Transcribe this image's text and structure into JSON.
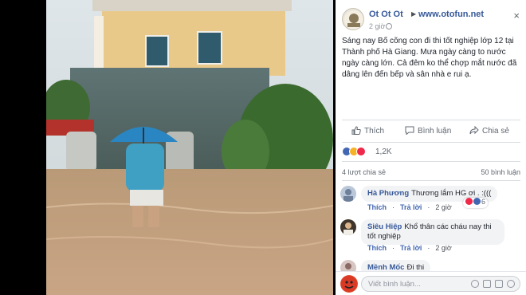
{
  "post": {
    "author": "Ot Ot Ot",
    "arrow": "▶",
    "page": "www.otofun.net",
    "time": "2 giờ",
    "text": "Sáng nay Bố cõng con đi thi tốt nghiệp lớp 12 tại Thành phố Hà Giang. Mưa ngày càng to nước ngày càng lớn. Cả đêm ko thể chợp mắt nước đã dâng lên đến bếp và sân nhà e rui ạ.",
    "close": "×"
  },
  "actions": {
    "like": "Thích",
    "comment": "Bình luận",
    "share": "Chia sẻ"
  },
  "reactions": {
    "count": "1,2K",
    "colors": [
      "#4267b2",
      "#f7b125",
      "#f0284a"
    ]
  },
  "stats": {
    "shares": "4 lượt chia sẻ",
    "comments": "50 bình luận"
  },
  "comments": [
    {
      "name": "Hà Phương",
      "text": "Thương lắm HG ơi . :(((",
      "like": "Thích",
      "reply": "Trả lời",
      "time": "2 giờ",
      "reaction_count": "6"
    },
    {
      "name": "Siêu Hiệp",
      "text": "Khổ thân các cháu nay thi tốt nghiệp",
      "like": "Thích",
      "reply": "Trả lời",
      "time": "2 giờ"
    },
    {
      "name": "Mềnh Mốc",
      "text": "Đi thi"
    }
  ],
  "composer": {
    "placeholder": "Viết bình luận..."
  }
}
